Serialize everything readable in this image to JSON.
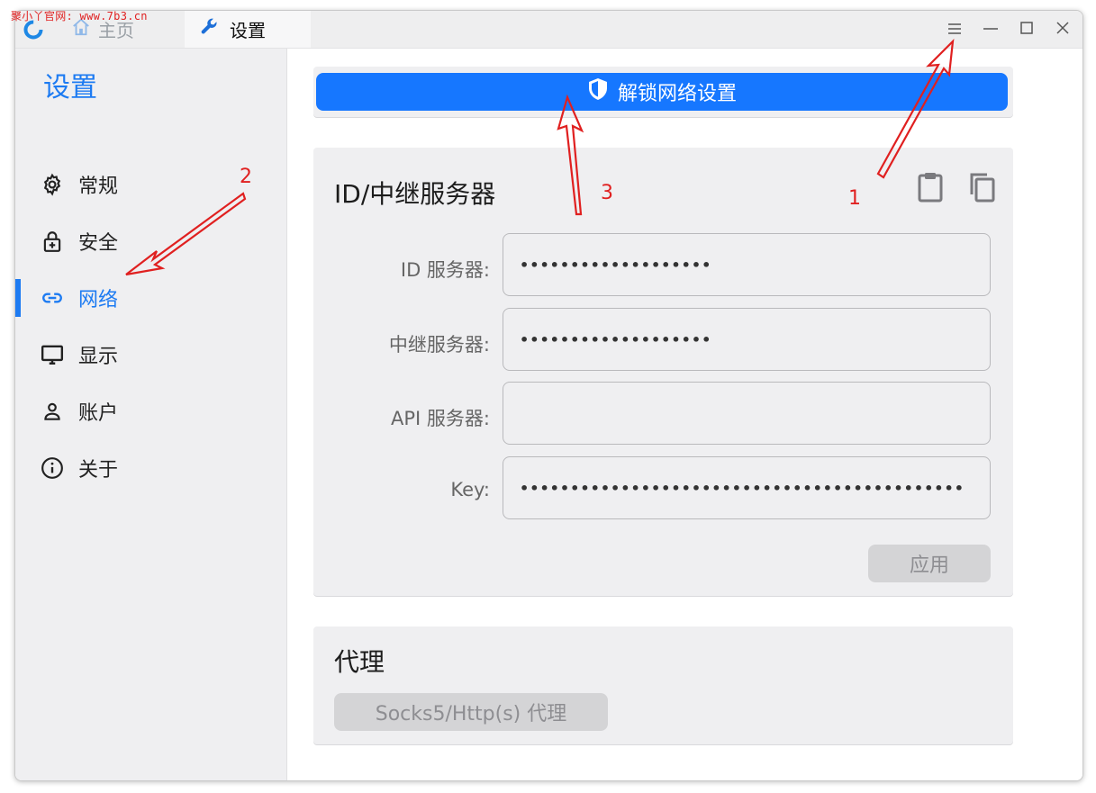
{
  "watermark": "聚小丫官网: www.7b3.cn",
  "titlebar": {
    "tabs": [
      {
        "label": "主页",
        "icon": "home-icon"
      },
      {
        "label": "设置",
        "icon": "wrench-icon"
      }
    ],
    "controls": [
      "menu-icon",
      "minimize-icon",
      "maximize-icon",
      "close-icon"
    ]
  },
  "sidebar": {
    "title": "设置",
    "items": [
      {
        "label": "常规",
        "icon": "gear-icon"
      },
      {
        "label": "安全",
        "icon": "lock-icon"
      },
      {
        "label": "网络",
        "icon": "link-icon",
        "active": true
      },
      {
        "label": "显示",
        "icon": "monitor-icon"
      },
      {
        "label": "账户",
        "icon": "user-icon"
      },
      {
        "label": "关于",
        "icon": "info-icon"
      }
    ]
  },
  "unlock": {
    "label": "解锁网络设置",
    "icon": "shield-icon"
  },
  "server": {
    "title": "ID/中继服务器",
    "fields": [
      {
        "label": "ID 服务器:",
        "value": "•••••••••••••••••••"
      },
      {
        "label": "中继服务器:",
        "value": "•••••••••••••••••••"
      },
      {
        "label": "API 服务器:",
        "value": ""
      },
      {
        "label": "Key:",
        "value": "••••••••••••••••••••••••••••••••••••••••••••"
      }
    ],
    "apply": "应用"
  },
  "proxy": {
    "title": "代理",
    "button": "Socks5/Http(s) 代理"
  },
  "annotations": [
    "1",
    "2",
    "3"
  ],
  "colors": {
    "accent": "#1677ff",
    "annotation": "#e02020"
  }
}
